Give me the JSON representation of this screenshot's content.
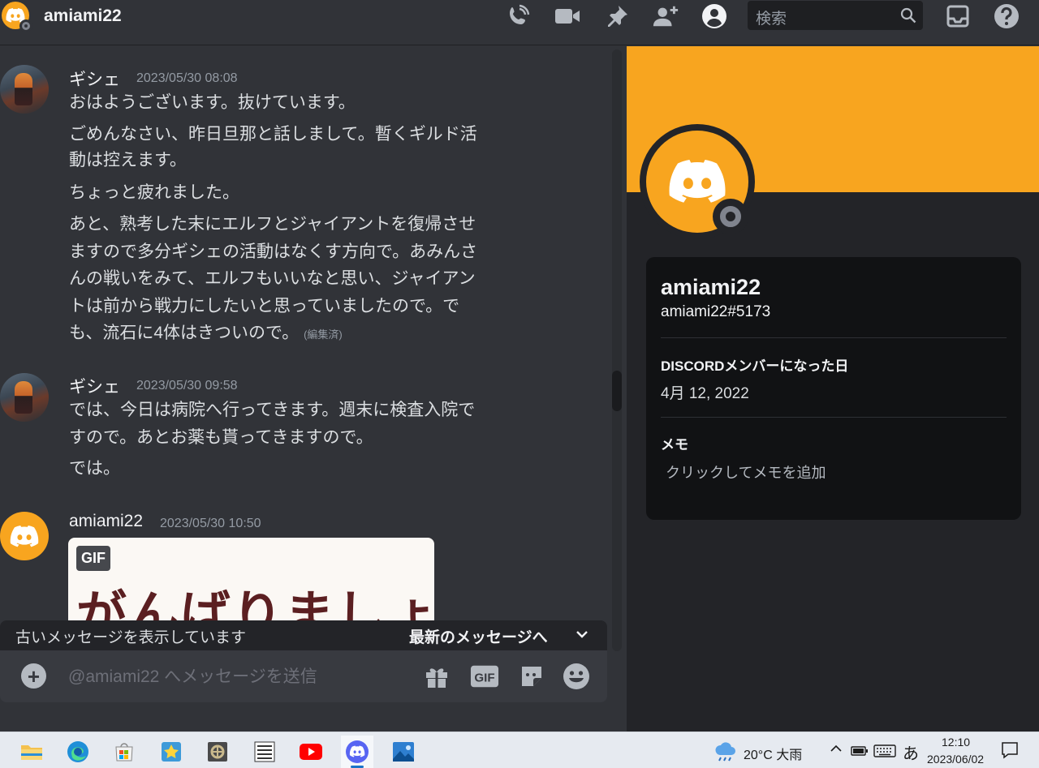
{
  "header": {
    "title": "amiami22",
    "search_placeholder": "検索"
  },
  "messages": [
    {
      "author": "ギシェ",
      "timestamp": "2023/05/30 08:08",
      "lines": [
        "おはようございます。抜けています。",
        "ごめんなさい、昨日旦那と話しまして。暫くギルド活",
        "動は控えます。",
        "ちょっと疲れました。",
        "あと、熟考した末にエルフとジャイアントを復帰させ",
        "ますので多分ギシェの活動はなくす方向で。あみんさ",
        "んの戦いをみて、エルフもいいなと思い、ジャイアン",
        "トは前から戦力にしたいと思っていましたので。で",
        "も、流石に4体はきついので。"
      ],
      "edited": "(編集済)"
    },
    {
      "author": "ギシェ",
      "timestamp": "2023/05/30 09:58",
      "lines": [
        "では、今日は病院へ行ってきます。週末に検査入院で",
        "すので。あとお薬も貰ってきますので。",
        "では。"
      ]
    },
    {
      "author": "amiami22",
      "timestamp": "2023/05/30 10:50",
      "gif_badge": "GIF",
      "gif_text": "がんばりましょう!"
    }
  ],
  "old_messages_bar": {
    "label": "古いメッセージを表示しています",
    "jump": "最新のメッセージへ"
  },
  "composer": {
    "placeholder": "@amiami22 へメッセージを送信",
    "gif_label": "GIF"
  },
  "profile": {
    "name": "amiami22",
    "tag": "amiami22#5173",
    "member_since_label": "DISCORDメンバーになった日",
    "member_since": "4月 12, 2022",
    "note_label": "メモ",
    "note_placeholder": "クリックしてメモを追加"
  },
  "taskbar": {
    "weather": "20°C 大雨",
    "ime": "あ",
    "time": "12:10",
    "date": "2023/06/02"
  },
  "colors": {
    "accent": "#f8a51f",
    "background": "#313338",
    "card": "#111214"
  }
}
